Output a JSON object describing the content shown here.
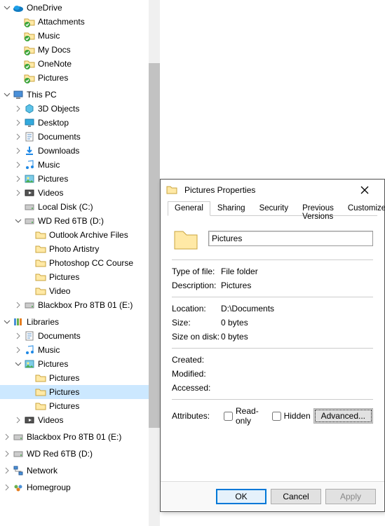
{
  "tree": [
    {
      "depth": 0,
      "chev": "open",
      "icon": "onedrive",
      "label": "OneDrive"
    },
    {
      "depth": 1,
      "chev": "",
      "icon": "sync-folder",
      "label": "Attachments"
    },
    {
      "depth": 1,
      "chev": "",
      "icon": "sync-folder",
      "label": "Music"
    },
    {
      "depth": 1,
      "chev": "",
      "icon": "sync-folder",
      "label": "My Docs"
    },
    {
      "depth": 1,
      "chev": "",
      "icon": "sync-folder",
      "label": "OneNote"
    },
    {
      "depth": 1,
      "chev": "",
      "icon": "sync-folder",
      "label": "Pictures"
    },
    {
      "depth": 0,
      "chev": "open",
      "icon": "pc",
      "label": "This PC"
    },
    {
      "depth": 1,
      "chev": "closed",
      "icon": "3d",
      "label": "3D Objects"
    },
    {
      "depth": 1,
      "chev": "closed",
      "icon": "desktop",
      "label": "Desktop"
    },
    {
      "depth": 1,
      "chev": "closed",
      "icon": "docs",
      "label": "Documents"
    },
    {
      "depth": 1,
      "chev": "closed",
      "icon": "downloads",
      "label": "Downloads"
    },
    {
      "depth": 1,
      "chev": "closed",
      "icon": "music",
      "label": "Music"
    },
    {
      "depth": 1,
      "chev": "closed",
      "icon": "pictures",
      "label": "Pictures"
    },
    {
      "depth": 1,
      "chev": "closed",
      "icon": "videos",
      "label": "Videos"
    },
    {
      "depth": 1,
      "chev": "",
      "icon": "disk",
      "label": "Local Disk (C:)"
    },
    {
      "depth": 1,
      "chev": "open",
      "icon": "disk",
      "label": "WD Red 6TB (D:)"
    },
    {
      "depth": 2,
      "chev": "",
      "icon": "folder",
      "label": "Outlook Archive Files"
    },
    {
      "depth": 2,
      "chev": "",
      "icon": "folder",
      "label": "Photo Artistry"
    },
    {
      "depth": 2,
      "chev": "",
      "icon": "folder",
      "label": "Photoshop CC Course"
    },
    {
      "depth": 2,
      "chev": "",
      "icon": "folder",
      "label": "Pictures"
    },
    {
      "depth": 2,
      "chev": "",
      "icon": "folder",
      "label": "Video"
    },
    {
      "depth": 1,
      "chev": "closed",
      "icon": "disk",
      "label": "Blackbox Pro 8TB 01 (E:)"
    },
    {
      "depth": 0,
      "chev": "open",
      "icon": "libs",
      "label": "Libraries"
    },
    {
      "depth": 1,
      "chev": "closed",
      "icon": "docs",
      "label": "Documents"
    },
    {
      "depth": 1,
      "chev": "closed",
      "icon": "music",
      "label": "Music"
    },
    {
      "depth": 1,
      "chev": "open",
      "icon": "pictures",
      "label": "Pictures"
    },
    {
      "depth": 2,
      "chev": "",
      "icon": "folder",
      "label": "Pictures"
    },
    {
      "depth": 2,
      "chev": "",
      "icon": "folder",
      "label": "Pictures",
      "selected": true
    },
    {
      "depth": 2,
      "chev": "",
      "icon": "folder",
      "label": "Pictures"
    },
    {
      "depth": 1,
      "chev": "closed",
      "icon": "videos",
      "label": "Videos"
    },
    {
      "depth": 0,
      "chev": "closed",
      "icon": "disk",
      "label": "Blackbox Pro 8TB 01 (E:)"
    },
    {
      "depth": 0,
      "chev": "closed",
      "icon": "disk",
      "label": "WD Red 6TB (D:)"
    },
    {
      "depth": 0,
      "chev": "closed",
      "icon": "network",
      "label": "Network"
    },
    {
      "depth": 0,
      "chev": "closed",
      "icon": "homegroup",
      "label": "Homegroup"
    }
  ],
  "dialog": {
    "title": "Pictures Properties",
    "tabs": [
      "General",
      "Sharing",
      "Security",
      "Previous Versions",
      "Customize"
    ],
    "active_tab": 0,
    "name_value": "Pictures",
    "rows1": [
      {
        "label": "Type of file:",
        "value": "File folder"
      },
      {
        "label": "Description:",
        "value": "Pictures"
      }
    ],
    "rows2": [
      {
        "label": "Location:",
        "value": "D:\\Documents"
      },
      {
        "label": "Size:",
        "value": "0 bytes"
      },
      {
        "label": "Size on disk:",
        "value": "0 bytes"
      }
    ],
    "rows3": [
      {
        "label": "Created:",
        "value": ""
      },
      {
        "label": "Modified:",
        "value": ""
      },
      {
        "label": "Accessed:",
        "value": ""
      }
    ],
    "attributes_label": "Attributes:",
    "readonly_label": "Read-only",
    "hidden_label": "Hidden",
    "advanced_label": "Advanced...",
    "buttons": {
      "ok": "OK",
      "cancel": "Cancel",
      "apply": "Apply"
    }
  }
}
